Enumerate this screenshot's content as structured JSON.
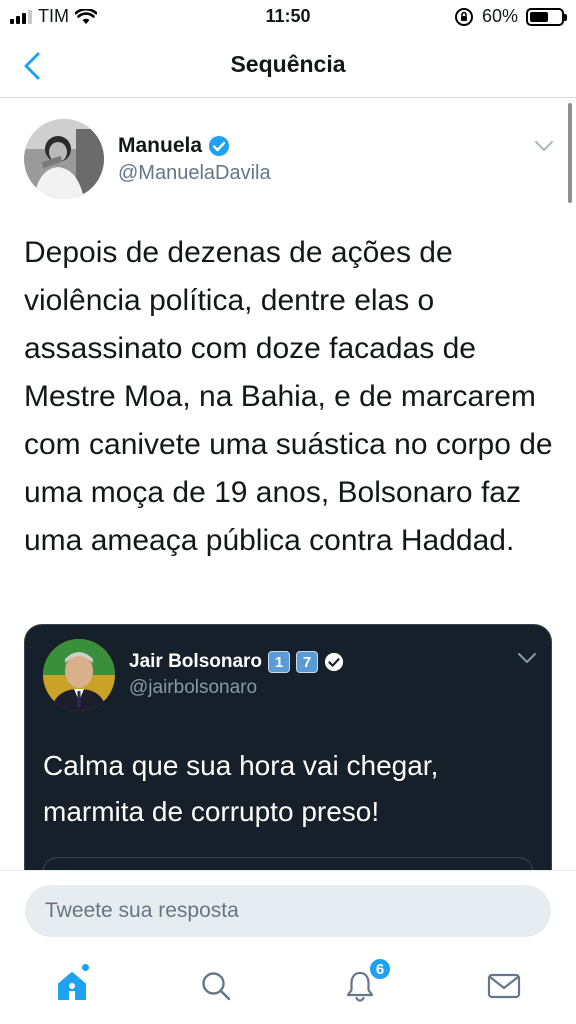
{
  "status_bar": {
    "carrier": "TIM",
    "time": "11:50",
    "battery": "60%",
    "battery_level": 0.6
  },
  "nav": {
    "title": "Sequência"
  },
  "tweet": {
    "author_name": "Manuela",
    "author_handle": "@ManuelaDavila",
    "text": "Depois de dezenas de ações de violência política, dentre elas o assassinato com doze facadas de Mestre Moa, na Bahia, e de marcarem com canivete uma suástica no corpo de uma moça de 19 anos, Bolsonaro faz uma ameaça pública contra Haddad."
  },
  "quoted_tweet": {
    "author_name": "Jair Bolsonaro",
    "author_badges": [
      "1",
      "7"
    ],
    "author_handle": "@jairbolsonaro",
    "text": "Calma que sua hora vai chegar, marmita de corrupto preso!"
  },
  "reply": {
    "placeholder": "Tweete sua resposta"
  },
  "tabbar": {
    "notifications_count": "6"
  },
  "colors": {
    "accent": "#1da1f2",
    "quote_background": "#15202b",
    "secondary_text": "#657786"
  },
  "icons": [
    "back-chevron-icon",
    "verified-icon",
    "chevron-down-icon",
    "home-icon",
    "search-icon",
    "notifications-bell-icon",
    "messages-envelope-icon",
    "wifi-icon",
    "signal-icon",
    "battery-icon",
    "orientation-lock-icon"
  ]
}
